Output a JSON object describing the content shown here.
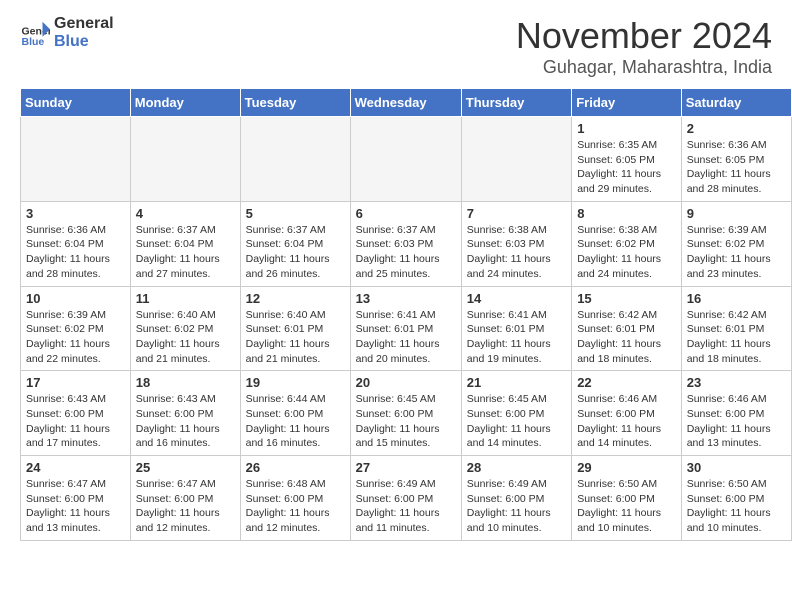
{
  "header": {
    "logo_line1": "General",
    "logo_line2": "Blue",
    "month_title": "November 2024",
    "location": "Guhagar, Maharashtra, India"
  },
  "days_of_week": [
    "Sunday",
    "Monday",
    "Tuesday",
    "Wednesday",
    "Thursday",
    "Friday",
    "Saturday"
  ],
  "weeks": [
    [
      {
        "day": "",
        "info": ""
      },
      {
        "day": "",
        "info": ""
      },
      {
        "day": "",
        "info": ""
      },
      {
        "day": "",
        "info": ""
      },
      {
        "day": "",
        "info": ""
      },
      {
        "day": "1",
        "info": "Sunrise: 6:35 AM\nSunset: 6:05 PM\nDaylight: 11 hours and 29 minutes."
      },
      {
        "day": "2",
        "info": "Sunrise: 6:36 AM\nSunset: 6:05 PM\nDaylight: 11 hours and 28 minutes."
      }
    ],
    [
      {
        "day": "3",
        "info": "Sunrise: 6:36 AM\nSunset: 6:04 PM\nDaylight: 11 hours and 28 minutes."
      },
      {
        "day": "4",
        "info": "Sunrise: 6:37 AM\nSunset: 6:04 PM\nDaylight: 11 hours and 27 minutes."
      },
      {
        "day": "5",
        "info": "Sunrise: 6:37 AM\nSunset: 6:04 PM\nDaylight: 11 hours and 26 minutes."
      },
      {
        "day": "6",
        "info": "Sunrise: 6:37 AM\nSunset: 6:03 PM\nDaylight: 11 hours and 25 minutes."
      },
      {
        "day": "7",
        "info": "Sunrise: 6:38 AM\nSunset: 6:03 PM\nDaylight: 11 hours and 24 minutes."
      },
      {
        "day": "8",
        "info": "Sunrise: 6:38 AM\nSunset: 6:02 PM\nDaylight: 11 hours and 24 minutes."
      },
      {
        "day": "9",
        "info": "Sunrise: 6:39 AM\nSunset: 6:02 PM\nDaylight: 11 hours and 23 minutes."
      }
    ],
    [
      {
        "day": "10",
        "info": "Sunrise: 6:39 AM\nSunset: 6:02 PM\nDaylight: 11 hours and 22 minutes."
      },
      {
        "day": "11",
        "info": "Sunrise: 6:40 AM\nSunset: 6:02 PM\nDaylight: 11 hours and 21 minutes."
      },
      {
        "day": "12",
        "info": "Sunrise: 6:40 AM\nSunset: 6:01 PM\nDaylight: 11 hours and 21 minutes."
      },
      {
        "day": "13",
        "info": "Sunrise: 6:41 AM\nSunset: 6:01 PM\nDaylight: 11 hours and 20 minutes."
      },
      {
        "day": "14",
        "info": "Sunrise: 6:41 AM\nSunset: 6:01 PM\nDaylight: 11 hours and 19 minutes."
      },
      {
        "day": "15",
        "info": "Sunrise: 6:42 AM\nSunset: 6:01 PM\nDaylight: 11 hours and 18 minutes."
      },
      {
        "day": "16",
        "info": "Sunrise: 6:42 AM\nSunset: 6:01 PM\nDaylight: 11 hours and 18 minutes."
      }
    ],
    [
      {
        "day": "17",
        "info": "Sunrise: 6:43 AM\nSunset: 6:00 PM\nDaylight: 11 hours and 17 minutes."
      },
      {
        "day": "18",
        "info": "Sunrise: 6:43 AM\nSunset: 6:00 PM\nDaylight: 11 hours and 16 minutes."
      },
      {
        "day": "19",
        "info": "Sunrise: 6:44 AM\nSunset: 6:00 PM\nDaylight: 11 hours and 16 minutes."
      },
      {
        "day": "20",
        "info": "Sunrise: 6:45 AM\nSunset: 6:00 PM\nDaylight: 11 hours and 15 minutes."
      },
      {
        "day": "21",
        "info": "Sunrise: 6:45 AM\nSunset: 6:00 PM\nDaylight: 11 hours and 14 minutes."
      },
      {
        "day": "22",
        "info": "Sunrise: 6:46 AM\nSunset: 6:00 PM\nDaylight: 11 hours and 14 minutes."
      },
      {
        "day": "23",
        "info": "Sunrise: 6:46 AM\nSunset: 6:00 PM\nDaylight: 11 hours and 13 minutes."
      }
    ],
    [
      {
        "day": "24",
        "info": "Sunrise: 6:47 AM\nSunset: 6:00 PM\nDaylight: 11 hours and 13 minutes."
      },
      {
        "day": "25",
        "info": "Sunrise: 6:47 AM\nSunset: 6:00 PM\nDaylight: 11 hours and 12 minutes."
      },
      {
        "day": "26",
        "info": "Sunrise: 6:48 AM\nSunset: 6:00 PM\nDaylight: 11 hours and 12 minutes."
      },
      {
        "day": "27",
        "info": "Sunrise: 6:49 AM\nSunset: 6:00 PM\nDaylight: 11 hours and 11 minutes."
      },
      {
        "day": "28",
        "info": "Sunrise: 6:49 AM\nSunset: 6:00 PM\nDaylight: 11 hours and 10 minutes."
      },
      {
        "day": "29",
        "info": "Sunrise: 6:50 AM\nSunset: 6:00 PM\nDaylight: 11 hours and 10 minutes."
      },
      {
        "day": "30",
        "info": "Sunrise: 6:50 AM\nSunset: 6:00 PM\nDaylight: 11 hours and 10 minutes."
      }
    ]
  ]
}
